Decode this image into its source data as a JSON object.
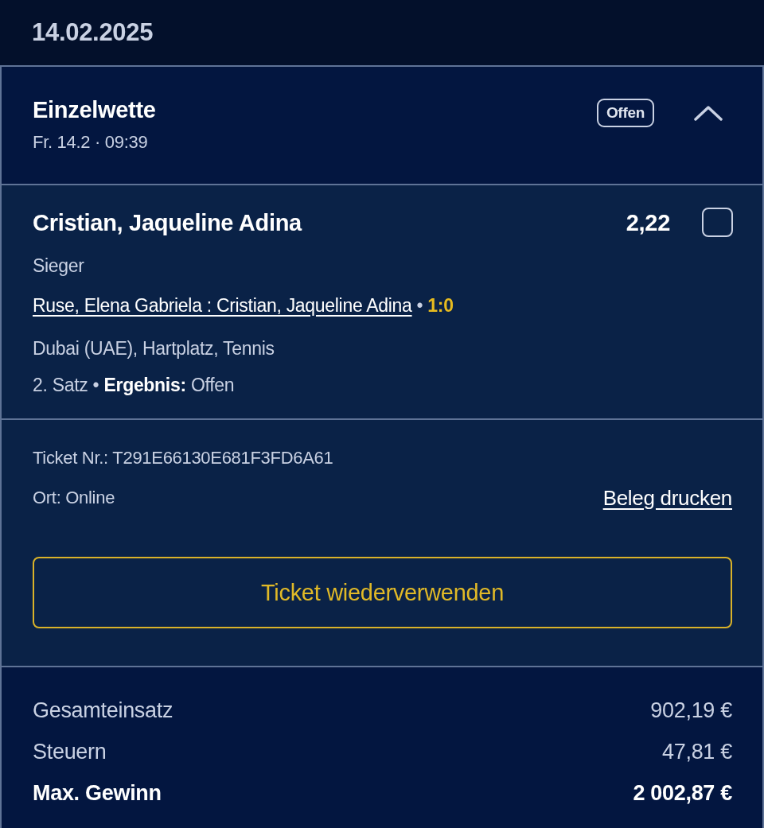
{
  "date": "14.02.2025",
  "bet": {
    "type": "Einzelwette",
    "datetime": "Fr. 14.2 · 09:39",
    "status": "Offen",
    "expanded": true
  },
  "selection": {
    "name": "Cristian, Jaqueline Adina",
    "odds": "2,22",
    "checked": false,
    "market": "Sieger",
    "match": "Ruse, Elena Gabriela : Cristian, Jaqueline Adina",
    "separator": "•",
    "score": "1:0",
    "event": "Dubai (UAE), Hartplatz, Tennis",
    "status_line": "2. Satz • **Ergebnis:** Offen"
  },
  "ticket": {
    "number": "Ticket Nr.: T291E66130E681F3FD6A61",
    "location": "Ort: Online",
    "print_link": "Beleg drucken",
    "reuse_button": "Ticket wiederverwenden"
  },
  "summary": [
    {
      "label": "Gesamteinsatz",
      "value": "902,19 €",
      "emphasis": false
    },
    {
      "label": "Steuern",
      "value": "47,81 €",
      "emphasis": false
    },
    {
      "label": "Max. Gewinn",
      "value": "2 002,87 €",
      "emphasis": true
    }
  ]
}
